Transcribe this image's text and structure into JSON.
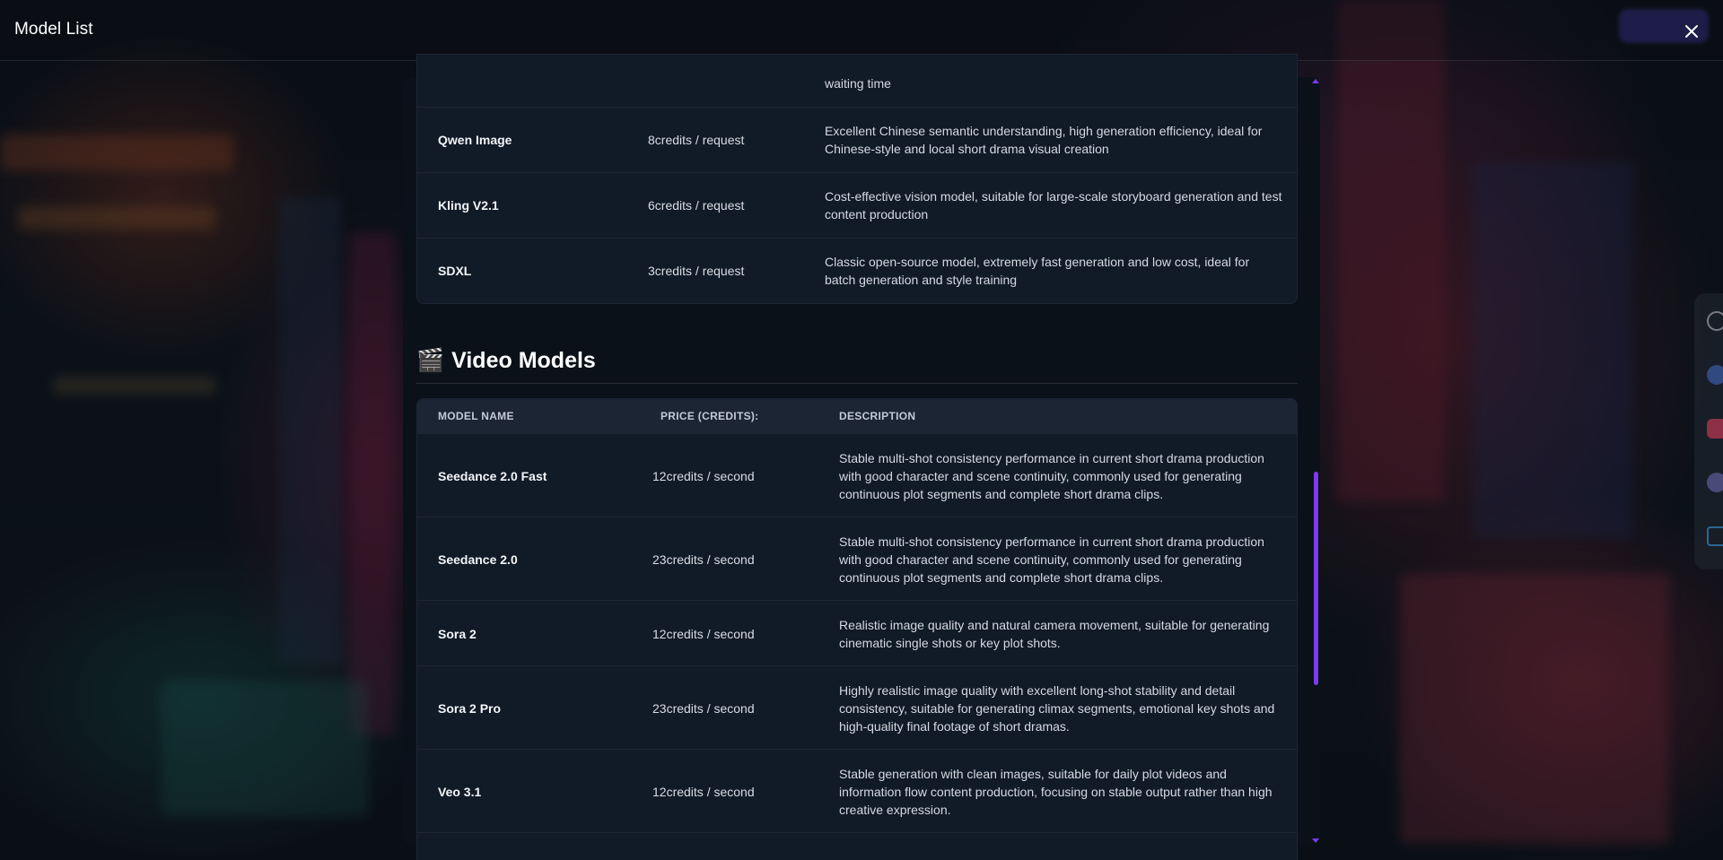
{
  "header": {
    "title": "Model List",
    "close_icon": "close-icon"
  },
  "image_models": {
    "truncated_desc_tail": "waiting time",
    "rows": [
      {
        "name": "Qwen Image",
        "price": "8credits / request",
        "description": "Excellent Chinese semantic understanding, high generation efficiency, ideal for Chinese-style and local short drama visual creation"
      },
      {
        "name": "Kling V2.1",
        "price": "6credits / request",
        "description": "Cost-effective vision model, suitable for large-scale storyboard generation and test content production"
      },
      {
        "name": "SDXL",
        "price": "3credits / request",
        "description": "Classic open-source model, extremely fast generation and low cost, ideal for batch generation and style training"
      }
    ]
  },
  "video_models": {
    "heading_icon": "🎬",
    "heading": "Video Models",
    "columns": {
      "name": "MODEL NAME",
      "price": "PRICE (CREDITS):",
      "description": "DESCRIPTION"
    },
    "rows": [
      {
        "name": "Seedance 2.0 Fast",
        "price": "12credits / second",
        "description": "Stable multi-shot consistency performance in current short drama production with good character and scene continuity, commonly used for generating continuous plot segments and complete short drama clips."
      },
      {
        "name": "Seedance 2.0",
        "price": "23credits / second",
        "description": "Stable multi-shot consistency performance in current short drama production with good character and scene continuity, commonly used for generating continuous plot segments and complete short drama clips."
      },
      {
        "name": "Sora 2",
        "price": "12credits / second",
        "description": "Realistic image quality and natural camera movement, suitable for generating cinematic single shots or key plot shots."
      },
      {
        "name": "Sora 2 Pro",
        "price": "23credits / second",
        "description": "Highly realistic image quality with excellent long-shot stability and detail consistency, suitable for generating climax segments, emotional key shots and high-quality final footage of short dramas."
      },
      {
        "name": "Veo 3.1",
        "price": "12credits / second",
        "description": "Stable generation with clean images, suitable for daily plot videos and information flow content production, focusing on stable output rather than high creative expression."
      }
    ]
  },
  "social_icons": [
    "x-icon",
    "facebook-icon",
    "instagram-icon",
    "discord-icon",
    "email-icon"
  ],
  "colors": {
    "accent": "#7c3aed",
    "panel_bg": "#0b1119",
    "table_bg": "#111a27",
    "table_header_bg": "#1b2533"
  }
}
